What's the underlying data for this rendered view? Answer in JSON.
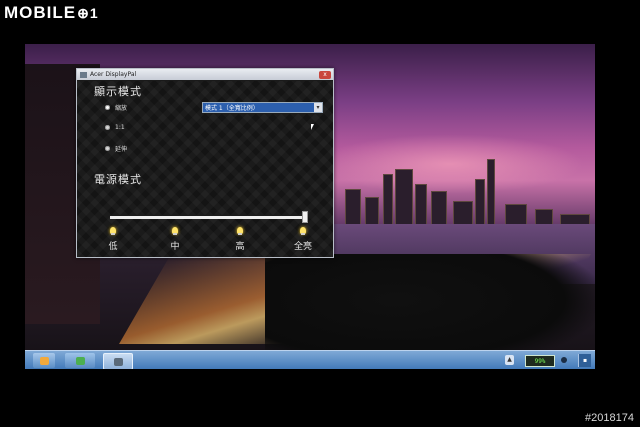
{
  "branding": {
    "logo_text": "MOBILE",
    "logo_mark": "⊕1",
    "watermark": "#2018174"
  },
  "window": {
    "title": "Acer DisplayPal",
    "close_label": "x",
    "display_mode": {
      "heading": "顯示模式",
      "options": [
        {
          "label": "縮放",
          "selected": true
        },
        {
          "label": "1:1",
          "selected": false
        },
        {
          "label": "延伸",
          "selected": false
        }
      ],
      "dropdown_value": "模式 1（全寬比例）"
    },
    "power_mode": {
      "heading": "電源模式",
      "slider_level": 1.0,
      "levels": [
        "低",
        "中",
        "高",
        "全亮"
      ]
    }
  },
  "taskbar": {
    "tray_arrow": "▲",
    "battery_percent": "99%",
    "show_desktop": "▪"
  }
}
